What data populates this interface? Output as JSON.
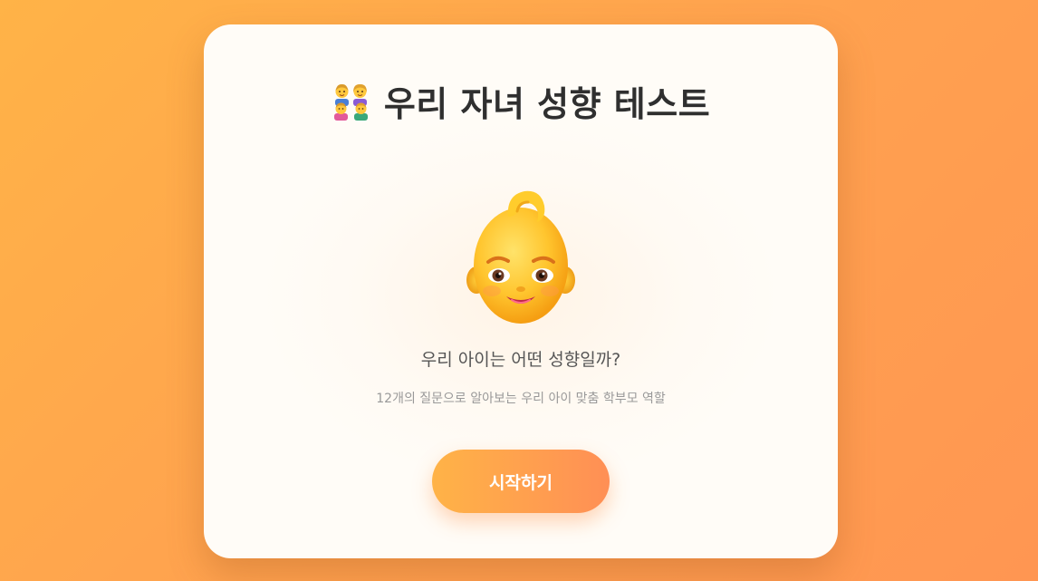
{
  "header": {
    "title": "우리 자녀 성향 테스트",
    "title_icon": "family-icon"
  },
  "hero": {
    "icon": "baby-face-icon"
  },
  "content": {
    "question": "우리 아이는 어떤 성향일까?",
    "subtitle": "12개의 질문으로 알아보는 우리 아이 맞춤 학부모 역할"
  },
  "actions": {
    "start_label": "시작하기"
  },
  "colors": {
    "background_start": "#ffb347",
    "background_end": "#ff9652",
    "card": "#fffcf7",
    "title_text": "#2f2f2f",
    "button_start": "#ffb347",
    "button_end": "#ff8f55"
  }
}
